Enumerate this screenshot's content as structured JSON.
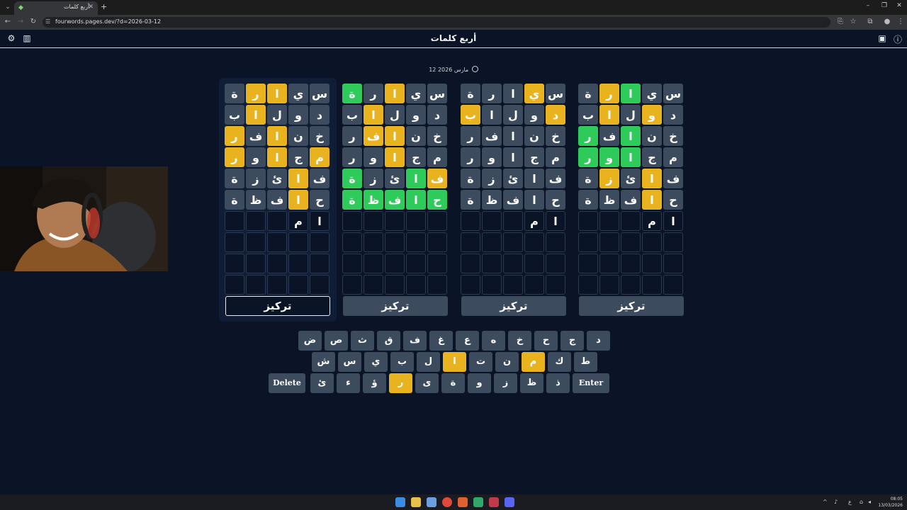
{
  "browser": {
    "tab_title": "أربع كلمات",
    "url": "fourwords.pages.dev/?d=2026-03-12"
  },
  "app": {
    "title": "أربع كلمات",
    "date": "12 مارس 2026"
  },
  "colors": {
    "background": "#0b1426",
    "tile_absent": "#3c4b5e",
    "tile_present": "#e9b320",
    "tile_correct": "#2fcb5a"
  },
  "boards": [
    {
      "focus_label": "تركيز",
      "rows": [
        [
          {
            "l": "س",
            "s": "gray"
          },
          {
            "l": "ي",
            "s": "gray"
          },
          {
            "l": "ا",
            "s": "yellow"
          },
          {
            "l": "ر",
            "s": "yellow"
          },
          {
            "l": "ة",
            "s": "gray"
          }
        ],
        [
          {
            "l": "د",
            "s": "gray"
          },
          {
            "l": "و",
            "s": "gray"
          },
          {
            "l": "ل",
            "s": "gray"
          },
          {
            "l": "ا",
            "s": "yellow"
          },
          {
            "l": "ب",
            "s": "gray"
          }
        ],
        [
          {
            "l": "خ",
            "s": "gray"
          },
          {
            "l": "ن",
            "s": "gray"
          },
          {
            "l": "ا",
            "s": "yellow"
          },
          {
            "l": "ف",
            "s": "gray"
          },
          {
            "l": "ر",
            "s": "yellow"
          }
        ],
        [
          {
            "l": "م",
            "s": "yellow"
          },
          {
            "l": "ج",
            "s": "gray"
          },
          {
            "l": "ا",
            "s": "yellow"
          },
          {
            "l": "و",
            "s": "gray"
          },
          {
            "l": "ر",
            "s": "yellow"
          }
        ],
        [
          {
            "l": "ف",
            "s": "gray"
          },
          {
            "l": "ا",
            "s": "yellow"
          },
          {
            "l": "ئ",
            "s": "gray"
          },
          {
            "l": "ز",
            "s": "gray"
          },
          {
            "l": "ة",
            "s": "gray"
          }
        ],
        [
          {
            "l": "ح",
            "s": "gray"
          },
          {
            "l": "ا",
            "s": "yellow"
          },
          {
            "l": "ف",
            "s": "gray"
          },
          {
            "l": "ظ",
            "s": "gray"
          },
          {
            "l": "ة",
            "s": "gray"
          }
        ],
        [
          {
            "l": "ا",
            "s": "typed"
          },
          {
            "l": "م",
            "s": "typed"
          },
          {
            "l": "",
            "s": "empty"
          },
          {
            "l": "",
            "s": "empty"
          },
          {
            "l": "",
            "s": "empty"
          }
        ],
        [
          {
            "l": "",
            "s": "empty"
          },
          {
            "l": "",
            "s": "empty"
          },
          {
            "l": "",
            "s": "empty"
          },
          {
            "l": "",
            "s": "empty"
          },
          {
            "l": "",
            "s": "empty"
          }
        ],
        [
          {
            "l": "",
            "s": "empty"
          },
          {
            "l": "",
            "s": "empty"
          },
          {
            "l": "",
            "s": "empty"
          },
          {
            "l": "",
            "s": "empty"
          },
          {
            "l": "",
            "s": "empty"
          }
        ],
        [
          {
            "l": "",
            "s": "empty"
          },
          {
            "l": "",
            "s": "empty"
          },
          {
            "l": "",
            "s": "empty"
          },
          {
            "l": "",
            "s": "empty"
          },
          {
            "l": "",
            "s": "empty"
          }
        ]
      ]
    },
    {
      "focus_label": "تركيز",
      "rows": [
        [
          {
            "l": "س",
            "s": "gray"
          },
          {
            "l": "ي",
            "s": "gray"
          },
          {
            "l": "ا",
            "s": "yellow"
          },
          {
            "l": "ر",
            "s": "gray"
          },
          {
            "l": "ة",
            "s": "green"
          }
        ],
        [
          {
            "l": "د",
            "s": "gray"
          },
          {
            "l": "و",
            "s": "gray"
          },
          {
            "l": "ل",
            "s": "gray"
          },
          {
            "l": "ا",
            "s": "yellow"
          },
          {
            "l": "ب",
            "s": "gray"
          }
        ],
        [
          {
            "l": "خ",
            "s": "gray"
          },
          {
            "l": "ن",
            "s": "gray"
          },
          {
            "l": "ا",
            "s": "yellow"
          },
          {
            "l": "ف",
            "s": "yellow"
          },
          {
            "l": "ر",
            "s": "gray"
          }
        ],
        [
          {
            "l": "م",
            "s": "gray"
          },
          {
            "l": "ج",
            "s": "gray"
          },
          {
            "l": "ا",
            "s": "yellow"
          },
          {
            "l": "و",
            "s": "gray"
          },
          {
            "l": "ر",
            "s": "gray"
          }
        ],
        [
          {
            "l": "ف",
            "s": "yellow"
          },
          {
            "l": "ا",
            "s": "green"
          },
          {
            "l": "ئ",
            "s": "gray"
          },
          {
            "l": "ز",
            "s": "gray"
          },
          {
            "l": "ة",
            "s": "green"
          }
        ],
        [
          {
            "l": "ح",
            "s": "green"
          },
          {
            "l": "ا",
            "s": "green"
          },
          {
            "l": "ف",
            "s": "green"
          },
          {
            "l": "ظ",
            "s": "green"
          },
          {
            "l": "ة",
            "s": "green"
          }
        ],
        [
          {
            "l": "",
            "s": "empty"
          },
          {
            "l": "",
            "s": "empty"
          },
          {
            "l": "",
            "s": "empty"
          },
          {
            "l": "",
            "s": "empty"
          },
          {
            "l": "",
            "s": "empty"
          }
        ],
        [
          {
            "l": "",
            "s": "empty"
          },
          {
            "l": "",
            "s": "empty"
          },
          {
            "l": "",
            "s": "empty"
          },
          {
            "l": "",
            "s": "empty"
          },
          {
            "l": "",
            "s": "empty"
          }
        ],
        [
          {
            "l": "",
            "s": "empty"
          },
          {
            "l": "",
            "s": "empty"
          },
          {
            "l": "",
            "s": "empty"
          },
          {
            "l": "",
            "s": "empty"
          },
          {
            "l": "",
            "s": "empty"
          }
        ],
        [
          {
            "l": "",
            "s": "empty"
          },
          {
            "l": "",
            "s": "empty"
          },
          {
            "l": "",
            "s": "empty"
          },
          {
            "l": "",
            "s": "empty"
          },
          {
            "l": "",
            "s": "empty"
          }
        ]
      ]
    },
    {
      "focus_label": "تركيز",
      "rows": [
        [
          {
            "l": "س",
            "s": "gray"
          },
          {
            "l": "ي",
            "s": "yellow"
          },
          {
            "l": "ا",
            "s": "gray"
          },
          {
            "l": "ر",
            "s": "gray"
          },
          {
            "l": "ة",
            "s": "gray"
          }
        ],
        [
          {
            "l": "د",
            "s": "yellow"
          },
          {
            "l": "و",
            "s": "gray"
          },
          {
            "l": "ل",
            "s": "gray"
          },
          {
            "l": "ا",
            "s": "gray"
          },
          {
            "l": "ب",
            "s": "yellow"
          }
        ],
        [
          {
            "l": "خ",
            "s": "gray"
          },
          {
            "l": "ن",
            "s": "gray"
          },
          {
            "l": "ا",
            "s": "gray"
          },
          {
            "l": "ف",
            "s": "gray"
          },
          {
            "l": "ر",
            "s": "gray"
          }
        ],
        [
          {
            "l": "م",
            "s": "gray"
          },
          {
            "l": "ج",
            "s": "gray"
          },
          {
            "l": "ا",
            "s": "gray"
          },
          {
            "l": "و",
            "s": "gray"
          },
          {
            "l": "ر",
            "s": "gray"
          }
        ],
        [
          {
            "l": "ف",
            "s": "gray"
          },
          {
            "l": "ا",
            "s": "gray"
          },
          {
            "l": "ئ",
            "s": "gray"
          },
          {
            "l": "ز",
            "s": "gray"
          },
          {
            "l": "ة",
            "s": "gray"
          }
        ],
        [
          {
            "l": "ح",
            "s": "gray"
          },
          {
            "l": "ا",
            "s": "gray"
          },
          {
            "l": "ف",
            "s": "gray"
          },
          {
            "l": "ظ",
            "s": "gray"
          },
          {
            "l": "ة",
            "s": "gray"
          }
        ],
        [
          {
            "l": "ا",
            "s": "typed"
          },
          {
            "l": "م",
            "s": "typed"
          },
          {
            "l": "",
            "s": "empty"
          },
          {
            "l": "",
            "s": "empty"
          },
          {
            "l": "",
            "s": "empty"
          }
        ],
        [
          {
            "l": "",
            "s": "empty"
          },
          {
            "l": "",
            "s": "empty"
          },
          {
            "l": "",
            "s": "empty"
          },
          {
            "l": "",
            "s": "empty"
          },
          {
            "l": "",
            "s": "empty"
          }
        ],
        [
          {
            "l": "",
            "s": "empty"
          },
          {
            "l": "",
            "s": "empty"
          },
          {
            "l": "",
            "s": "empty"
          },
          {
            "l": "",
            "s": "empty"
          },
          {
            "l": "",
            "s": "empty"
          }
        ],
        [
          {
            "l": "",
            "s": "empty"
          },
          {
            "l": "",
            "s": "empty"
          },
          {
            "l": "",
            "s": "empty"
          },
          {
            "l": "",
            "s": "empty"
          },
          {
            "l": "",
            "s": "empty"
          }
        ]
      ]
    },
    {
      "focus_label": "تركيز",
      "rows": [
        [
          {
            "l": "س",
            "s": "gray"
          },
          {
            "l": "ي",
            "s": "gray"
          },
          {
            "l": "ا",
            "s": "green"
          },
          {
            "l": "ر",
            "s": "yellow"
          },
          {
            "l": "ة",
            "s": "gray"
          }
        ],
        [
          {
            "l": "د",
            "s": "gray"
          },
          {
            "l": "و",
            "s": "yellow"
          },
          {
            "l": "ل",
            "s": "gray"
          },
          {
            "l": "ا",
            "s": "yellow"
          },
          {
            "l": "ب",
            "s": "gray"
          }
        ],
        [
          {
            "l": "خ",
            "s": "gray"
          },
          {
            "l": "ن",
            "s": "gray"
          },
          {
            "l": "ا",
            "s": "green"
          },
          {
            "l": "ف",
            "s": "gray"
          },
          {
            "l": "ر",
            "s": "green"
          }
        ],
        [
          {
            "l": "م",
            "s": "gray"
          },
          {
            "l": "ج",
            "s": "gray"
          },
          {
            "l": "ا",
            "s": "green"
          },
          {
            "l": "و",
            "s": "green"
          },
          {
            "l": "ر",
            "s": "green"
          }
        ],
        [
          {
            "l": "ف",
            "s": "gray"
          },
          {
            "l": "ا",
            "s": "yellow"
          },
          {
            "l": "ئ",
            "s": "gray"
          },
          {
            "l": "ز",
            "s": "yellow"
          },
          {
            "l": "ة",
            "s": "gray"
          }
        ],
        [
          {
            "l": "ح",
            "s": "gray"
          },
          {
            "l": "ا",
            "s": "yellow"
          },
          {
            "l": "ف",
            "s": "gray"
          },
          {
            "l": "ظ",
            "s": "gray"
          },
          {
            "l": "ة",
            "s": "gray"
          }
        ],
        [
          {
            "l": "ا",
            "s": "typed"
          },
          {
            "l": "م",
            "s": "typed"
          },
          {
            "l": "",
            "s": "empty"
          },
          {
            "l": "",
            "s": "empty"
          },
          {
            "l": "",
            "s": "empty"
          }
        ],
        [
          {
            "l": "",
            "s": "empty"
          },
          {
            "l": "",
            "s": "empty"
          },
          {
            "l": "",
            "s": "empty"
          },
          {
            "l": "",
            "s": "empty"
          },
          {
            "l": "",
            "s": "empty"
          }
        ],
        [
          {
            "l": "",
            "s": "empty"
          },
          {
            "l": "",
            "s": "empty"
          },
          {
            "l": "",
            "s": "empty"
          },
          {
            "l": "",
            "s": "empty"
          },
          {
            "l": "",
            "s": "empty"
          }
        ],
        [
          {
            "l": "",
            "s": "empty"
          },
          {
            "l": "",
            "s": "empty"
          },
          {
            "l": "",
            "s": "empty"
          },
          {
            "l": "",
            "s": "empty"
          },
          {
            "l": "",
            "s": "empty"
          }
        ]
      ]
    }
  ],
  "keyboard": {
    "rows": [
      [
        {
          "k": "د"
        },
        {
          "k": "ج"
        },
        {
          "k": "ح"
        },
        {
          "k": "خ"
        },
        {
          "k": "ه"
        },
        {
          "k": "ع"
        },
        {
          "k": "غ"
        },
        {
          "k": "ف"
        },
        {
          "k": "ق"
        },
        {
          "k": "ث"
        },
        {
          "k": "ص"
        },
        {
          "k": "ض"
        }
      ],
      [
        {
          "k": "ط"
        },
        {
          "k": "ك"
        },
        {
          "k": "م",
          "s": "yellow"
        },
        {
          "k": "ن"
        },
        {
          "k": "ت"
        },
        {
          "k": "ا",
          "s": "yellow"
        },
        {
          "k": "ل"
        },
        {
          "k": "ب"
        },
        {
          "k": "ي"
        },
        {
          "k": "س"
        },
        {
          "k": "ش"
        }
      ],
      [
        {
          "k": "Enter",
          "w": "wide"
        },
        {
          "k": "ذ"
        },
        {
          "k": "ظ"
        },
        {
          "k": "ز"
        },
        {
          "k": "و"
        },
        {
          "k": "ة"
        },
        {
          "k": "ى"
        },
        {
          "k": "ر",
          "s": "yellow"
        },
        {
          "k": "ؤ"
        },
        {
          "k": "ء"
        },
        {
          "k": "ئ"
        },
        {
          "k": "Delete",
          "w": "wide"
        }
      ]
    ]
  },
  "taskbar": {
    "time": "08:05",
    "date": "13/03/2026"
  }
}
